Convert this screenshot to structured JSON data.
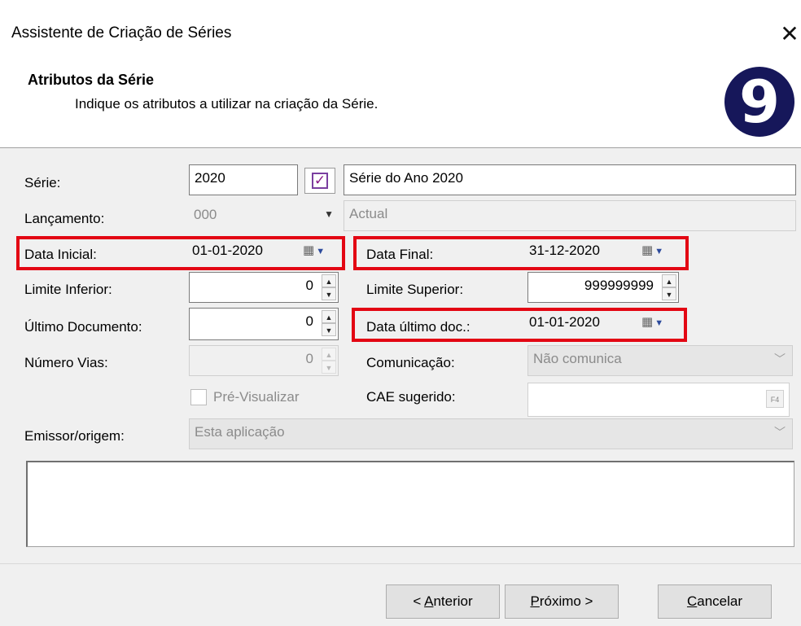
{
  "window": {
    "title": "Assistente de Criação de Séries",
    "close_glyph": "✕"
  },
  "header": {
    "title": "Atributos da Série",
    "subtitle": "Indique os atributos a utilizar na criação da Série.",
    "logo_text": "9"
  },
  "form": {
    "serie": {
      "label": "Série:",
      "code": "2020",
      "description": "Série do Ano 2020",
      "checked": true
    },
    "lancamento": {
      "label": "Lançamento:",
      "value": "000",
      "description": "Actual"
    },
    "data_inicial": {
      "label": "Data Inicial:",
      "value": "01-01-2020"
    },
    "data_final": {
      "label": "Data Final:",
      "value": "31-12-2020"
    },
    "limite_inferior": {
      "label": "Limite Inferior:",
      "value": "0"
    },
    "limite_superior": {
      "label": "Limite Superior:",
      "value": "999999999"
    },
    "ultimo_documento": {
      "label": "Último Documento:",
      "value": "0"
    },
    "data_ultimo_doc": {
      "label": "Data último doc.:",
      "value": "01-01-2020"
    },
    "numero_vias": {
      "label": "Número Vias:",
      "value": "0"
    },
    "comunicacao": {
      "label": "Comunicação:",
      "value": "Não comunica"
    },
    "pre_visualizar": {
      "label": "Pré-Visualizar"
    },
    "cae_sugerido": {
      "label": "CAE sugerido:",
      "value": ""
    },
    "emissor_origem": {
      "label": "Emissor/origem:",
      "value": "Esta aplicação"
    },
    "notes_text": ""
  },
  "buttons": {
    "anterior": {
      "prefix": "< ",
      "ul": "A",
      "rest": "nterior"
    },
    "proximo": {
      "ul": "P",
      "rest": "róximo >"
    },
    "cancelar": {
      "ul": "C",
      "rest": "ancelar"
    }
  },
  "icons": {
    "calendar": "calendar-icon",
    "spin_up": "▲",
    "spin_down": "▼",
    "dropdown": "﹀",
    "cae_lookup": "F4"
  },
  "colors": {
    "highlight": "#e30613",
    "logo_bg": "#16175a",
    "panel_bg": "#f0f0f0"
  }
}
